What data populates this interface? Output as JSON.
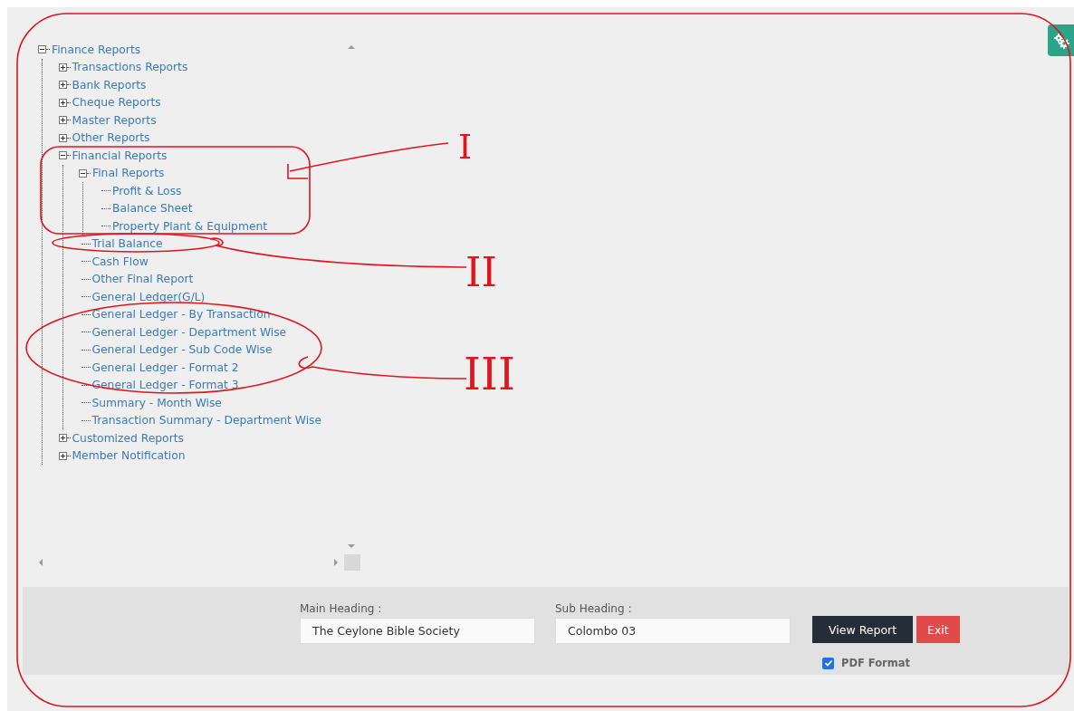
{
  "tree": {
    "label": "Finance Reports",
    "expanded": true,
    "children": [
      {
        "label": "Transactions Reports",
        "expanded": false
      },
      {
        "label": "Bank Reports",
        "expanded": false
      },
      {
        "label": "Cheque Reports",
        "expanded": false
      },
      {
        "label": "Master Reports",
        "expanded": false
      },
      {
        "label": "Other Reports",
        "expanded": false
      },
      {
        "label": "Financial Reports",
        "expanded": true,
        "children": [
          {
            "label": "Final Reports",
            "expanded": true,
            "children": [
              {
                "label": "Profit & Loss"
              },
              {
                "label": "Balance Sheet"
              },
              {
                "label": "Property Plant & Equipment"
              }
            ]
          },
          {
            "label": "Trial Balance"
          },
          {
            "label": "Cash Flow"
          },
          {
            "label": "Other Final Report"
          },
          {
            "label": "General Ledger(G/L)"
          },
          {
            "label": "General Ledger - By Transaction"
          },
          {
            "label": "General Ledger - Department Wise"
          },
          {
            "label": "General Ledger - Sub Code Wise"
          },
          {
            "label": "General Ledger - Format 2"
          },
          {
            "label": "General Ledger - Format 3"
          },
          {
            "label": "Summary - Month Wise"
          },
          {
            "label": "Transaction Summary - Department Wise"
          }
        ]
      },
      {
        "label": "Customized Reports",
        "expanded": false
      },
      {
        "label": "Member Notification",
        "expanded": false
      }
    ]
  },
  "form": {
    "main_heading": {
      "label": "Main Heading :",
      "value": "The Ceylone Bible Society"
    },
    "sub_heading": {
      "label": "Sub Heading :",
      "value": "Colombo 03"
    },
    "buttons": [
      {
        "label": "View Report",
        "kind": "primary"
      },
      {
        "label": "Exit",
        "kind": "danger"
      }
    ],
    "pdf_format": {
      "label": "PDF Format",
      "checked": true
    }
  },
  "annotations": [
    {
      "label": "I"
    },
    {
      "label": "II"
    },
    {
      "label": "III"
    }
  ]
}
